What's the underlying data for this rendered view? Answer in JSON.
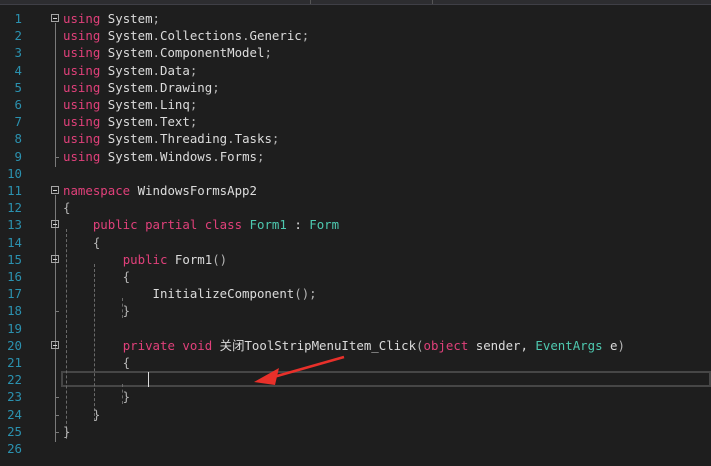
{
  "editor": {
    "lines": [
      {
        "n": "1",
        "tokens": [
          {
            "t": "using",
            "c": "kw"
          },
          {
            "t": " System",
            "c": "pl"
          },
          {
            "t": ";",
            "c": "pu"
          }
        ]
      },
      {
        "n": "2",
        "tokens": [
          {
            "t": "using",
            "c": "kw"
          },
          {
            "t": " System",
            "c": "pl"
          },
          {
            "t": ".",
            "c": "pu"
          },
          {
            "t": "Collections",
            "c": "pl"
          },
          {
            "t": ".",
            "c": "pu"
          },
          {
            "t": "Generic",
            "c": "pl"
          },
          {
            "t": ";",
            "c": "pu"
          }
        ]
      },
      {
        "n": "3",
        "tokens": [
          {
            "t": "using",
            "c": "kw"
          },
          {
            "t": " System",
            "c": "pl"
          },
          {
            "t": ".",
            "c": "pu"
          },
          {
            "t": "ComponentModel",
            "c": "pl"
          },
          {
            "t": ";",
            "c": "pu"
          }
        ]
      },
      {
        "n": "4",
        "tokens": [
          {
            "t": "using",
            "c": "kw"
          },
          {
            "t": " System",
            "c": "pl"
          },
          {
            "t": ".",
            "c": "pu"
          },
          {
            "t": "Data",
            "c": "pl"
          },
          {
            "t": ";",
            "c": "pu"
          }
        ]
      },
      {
        "n": "5",
        "tokens": [
          {
            "t": "using",
            "c": "kw"
          },
          {
            "t": " System",
            "c": "pl"
          },
          {
            "t": ".",
            "c": "pu"
          },
          {
            "t": "Drawing",
            "c": "pl"
          },
          {
            "t": ";",
            "c": "pu"
          }
        ]
      },
      {
        "n": "6",
        "tokens": [
          {
            "t": "using",
            "c": "kw"
          },
          {
            "t": " System",
            "c": "pl"
          },
          {
            "t": ".",
            "c": "pu"
          },
          {
            "t": "Linq",
            "c": "pl"
          },
          {
            "t": ";",
            "c": "pu"
          }
        ]
      },
      {
        "n": "7",
        "tokens": [
          {
            "t": "using",
            "c": "kw"
          },
          {
            "t": " System",
            "c": "pl"
          },
          {
            "t": ".",
            "c": "pu"
          },
          {
            "t": "Text",
            "c": "pl"
          },
          {
            "t": ";",
            "c": "pu"
          }
        ]
      },
      {
        "n": "8",
        "tokens": [
          {
            "t": "using",
            "c": "kw"
          },
          {
            "t": " System",
            "c": "pl"
          },
          {
            "t": ".",
            "c": "pu"
          },
          {
            "t": "Threading",
            "c": "pl"
          },
          {
            "t": ".",
            "c": "pu"
          },
          {
            "t": "Tasks",
            "c": "pl"
          },
          {
            "t": ";",
            "c": "pu"
          }
        ]
      },
      {
        "n": "9",
        "tokens": [
          {
            "t": "using",
            "c": "kw"
          },
          {
            "t": " System",
            "c": "pl"
          },
          {
            "t": ".",
            "c": "pu"
          },
          {
            "t": "Windows",
            "c": "pl"
          },
          {
            "t": ".",
            "c": "pu"
          },
          {
            "t": "Forms",
            "c": "pl"
          },
          {
            "t": ";",
            "c": "pu"
          }
        ]
      },
      {
        "n": "10",
        "tokens": []
      },
      {
        "n": "11",
        "tokens": [
          {
            "t": "namespace",
            "c": "kw"
          },
          {
            "t": " WindowsFormsApp2",
            "c": "pl"
          }
        ]
      },
      {
        "n": "12",
        "tokens": [
          {
            "t": "{",
            "c": "pu"
          }
        ]
      },
      {
        "n": "13",
        "tokens": [
          {
            "t": "    ",
            "c": "pl"
          },
          {
            "t": "public",
            "c": "kw"
          },
          {
            "t": " ",
            "c": "pl"
          },
          {
            "t": "partial",
            "c": "kw"
          },
          {
            "t": " ",
            "c": "pl"
          },
          {
            "t": "class",
            "c": "kw"
          },
          {
            "t": " ",
            "c": "pl"
          },
          {
            "t": "Form1",
            "c": "ty"
          },
          {
            "t": " : ",
            "c": "pl"
          },
          {
            "t": "Form",
            "c": "ty"
          }
        ]
      },
      {
        "n": "14",
        "tokens": [
          {
            "t": "    {",
            "c": "pu"
          }
        ]
      },
      {
        "n": "15",
        "tokens": [
          {
            "t": "        ",
            "c": "pl"
          },
          {
            "t": "public",
            "c": "kw"
          },
          {
            "t": " Form1",
            "c": "pl"
          },
          {
            "t": "()",
            "c": "pu"
          }
        ]
      },
      {
        "n": "16",
        "tokens": [
          {
            "t": "        {",
            "c": "pu"
          }
        ]
      },
      {
        "n": "17",
        "tokens": [
          {
            "t": "            InitializeComponent",
            "c": "pl"
          },
          {
            "t": "();",
            "c": "pu"
          }
        ]
      },
      {
        "n": "18",
        "tokens": [
          {
            "t": "        }",
            "c": "pu"
          }
        ]
      },
      {
        "n": "19",
        "tokens": []
      },
      {
        "n": "20",
        "tokens": [
          {
            "t": "        ",
            "c": "pl"
          },
          {
            "t": "private",
            "c": "kw"
          },
          {
            "t": " ",
            "c": "pl"
          },
          {
            "t": "void",
            "c": "kw"
          },
          {
            "t": " 关闭ToolStripMenuItem_Click",
            "c": "pl"
          },
          {
            "t": "(",
            "c": "pu"
          },
          {
            "t": "object",
            "c": "kw"
          },
          {
            "t": " sender, ",
            "c": "pl"
          },
          {
            "t": "EventArgs",
            "c": "ty"
          },
          {
            "t": " e",
            "c": "pl"
          },
          {
            "t": ")",
            "c": "pu"
          }
        ]
      },
      {
        "n": "21",
        "tokens": [
          {
            "t": "        {",
            "c": "pu"
          }
        ]
      },
      {
        "n": "22",
        "tokens": []
      },
      {
        "n": "23",
        "tokens": [
          {
            "t": "        }",
            "c": "pu"
          }
        ]
      },
      {
        "n": "24",
        "tokens": [
          {
            "t": "    }",
            "c": "pu"
          }
        ]
      },
      {
        "n": "25",
        "tokens": [
          {
            "t": "}",
            "c": "pu"
          }
        ]
      },
      {
        "n": "26",
        "tokens": []
      }
    ],
    "fold_lines": [
      "1",
      "11",
      "13",
      "15",
      "20"
    ],
    "caret_line": "22"
  },
  "colors": {
    "background": "#1e1e1e",
    "keyword": "#e0407a",
    "type": "#4ec9b0",
    "line_number": "#2b91af",
    "annotation_arrow": "#e8302a"
  }
}
